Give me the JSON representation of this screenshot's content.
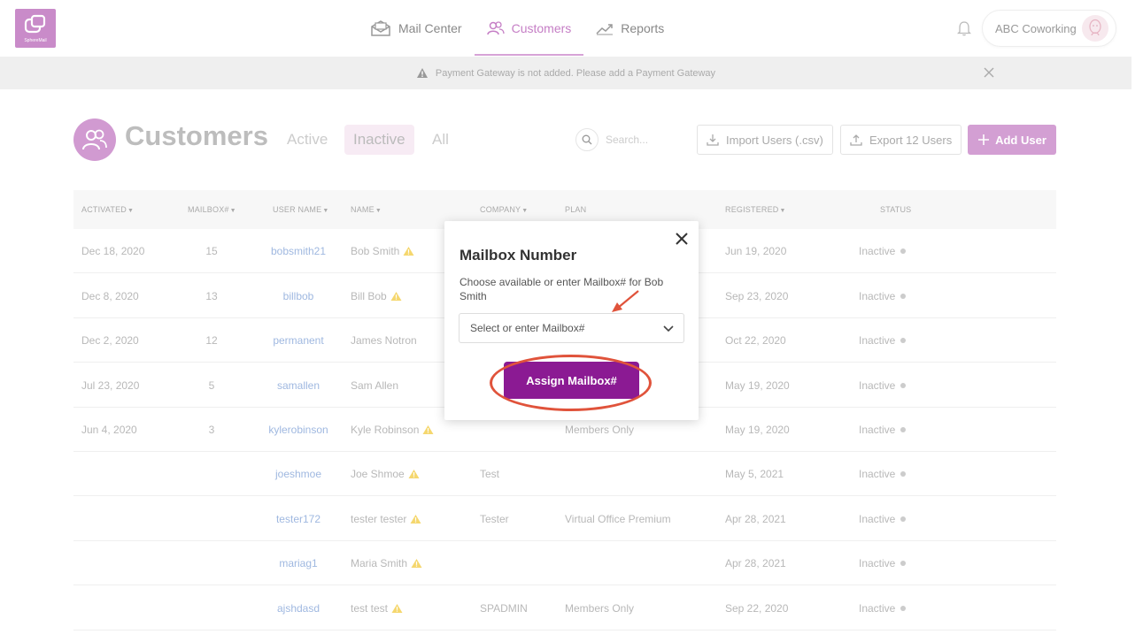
{
  "app": {
    "logo_text": "SphereMail"
  },
  "nav": {
    "tabs": [
      {
        "label": "Mail Center",
        "icon": "envelope-icon",
        "active": false
      },
      {
        "label": "Customers",
        "icon": "users-icon",
        "active": true
      },
      {
        "label": "Reports",
        "icon": "chart-line-icon",
        "active": false
      }
    ],
    "account_name": "ABC Coworking"
  },
  "banner": {
    "message": "Payment Gateway is not added. Please add a  Payment Gateway"
  },
  "page": {
    "title": "Customers",
    "filters": [
      "Active",
      "Inactive",
      "All"
    ],
    "active_filter": "Inactive",
    "search_placeholder": "Search...",
    "import_label": "Import Users (.csv)",
    "export_label": "Export 12 Users",
    "add_label": "Add User"
  },
  "table": {
    "headers": [
      "ACTIVATED",
      "MAILBOX#",
      "USER NAME",
      "NAME",
      "COMPANY",
      "PLAN",
      "REGISTERED",
      "STATUS"
    ],
    "rows": [
      {
        "activated": "Dec 18, 2020",
        "mailbox": "15",
        "username": "bobsmith21",
        "name": "Bob Smith",
        "warn": true,
        "company": "",
        "plan": "",
        "registered": "Jun 19, 2020",
        "status": "Inactive"
      },
      {
        "activated": "Dec 8, 2020",
        "mailbox": "13",
        "username": "billbob",
        "name": "Bill Bob",
        "warn": true,
        "company": "",
        "plan": "",
        "registered": "Sep 23, 2020",
        "status": "Inactive"
      },
      {
        "activated": "Dec 2, 2020",
        "mailbox": "12",
        "username": "permanent",
        "name": "James Notron",
        "warn": false,
        "company": "",
        "plan": "",
        "registered": "Oct 22, 2020",
        "status": "Inactive"
      },
      {
        "activated": "Jul 23, 2020",
        "mailbox": "5",
        "username": "samallen",
        "name": "Sam Allen",
        "warn": false,
        "company": "",
        "plan": "",
        "registered": "May 19, 2020",
        "status": "Inactive"
      },
      {
        "activated": "Jun 4, 2020",
        "mailbox": "3",
        "username": "kylerobinson",
        "name": "Kyle Robinson",
        "warn": true,
        "company": "",
        "plan": "Members Only",
        "registered": "May 19, 2020",
        "status": "Inactive"
      },
      {
        "activated": "",
        "mailbox": "",
        "username": "joeshmoe",
        "name": "Joe Shmoe",
        "warn": true,
        "company": "Test",
        "plan": "",
        "registered": "May 5, 2021",
        "status": "Inactive"
      },
      {
        "activated": "",
        "mailbox": "",
        "username": "tester172",
        "name": "tester tester",
        "warn": true,
        "company": "Tester",
        "plan": "Virtual Office Premium",
        "registered": "Apr 28, 2021",
        "status": "Inactive"
      },
      {
        "activated": "",
        "mailbox": "",
        "username": "mariag1",
        "name": "Maria Smith",
        "warn": true,
        "company": "",
        "plan": "",
        "registered": "Apr 28, 2021",
        "status": "Inactive"
      },
      {
        "activated": "",
        "mailbox": "",
        "username": "ajshdasd",
        "name": "test test",
        "warn": true,
        "company": "SPADMIN",
        "plan": "Members Only",
        "registered": "Sep 22, 2020",
        "status": "Inactive"
      }
    ]
  },
  "modal": {
    "title": "Mailbox Number",
    "description": "Choose available or enter Mailbox# for Bob Smith",
    "select_placeholder": "Select or enter Mailbox#",
    "assign_label": "Assign Mailbox#"
  },
  "colors": {
    "brand": "#c98bc9",
    "assign_button": "#8b1a93",
    "annotation": "#e0533b",
    "link": "#9fb8e0"
  }
}
